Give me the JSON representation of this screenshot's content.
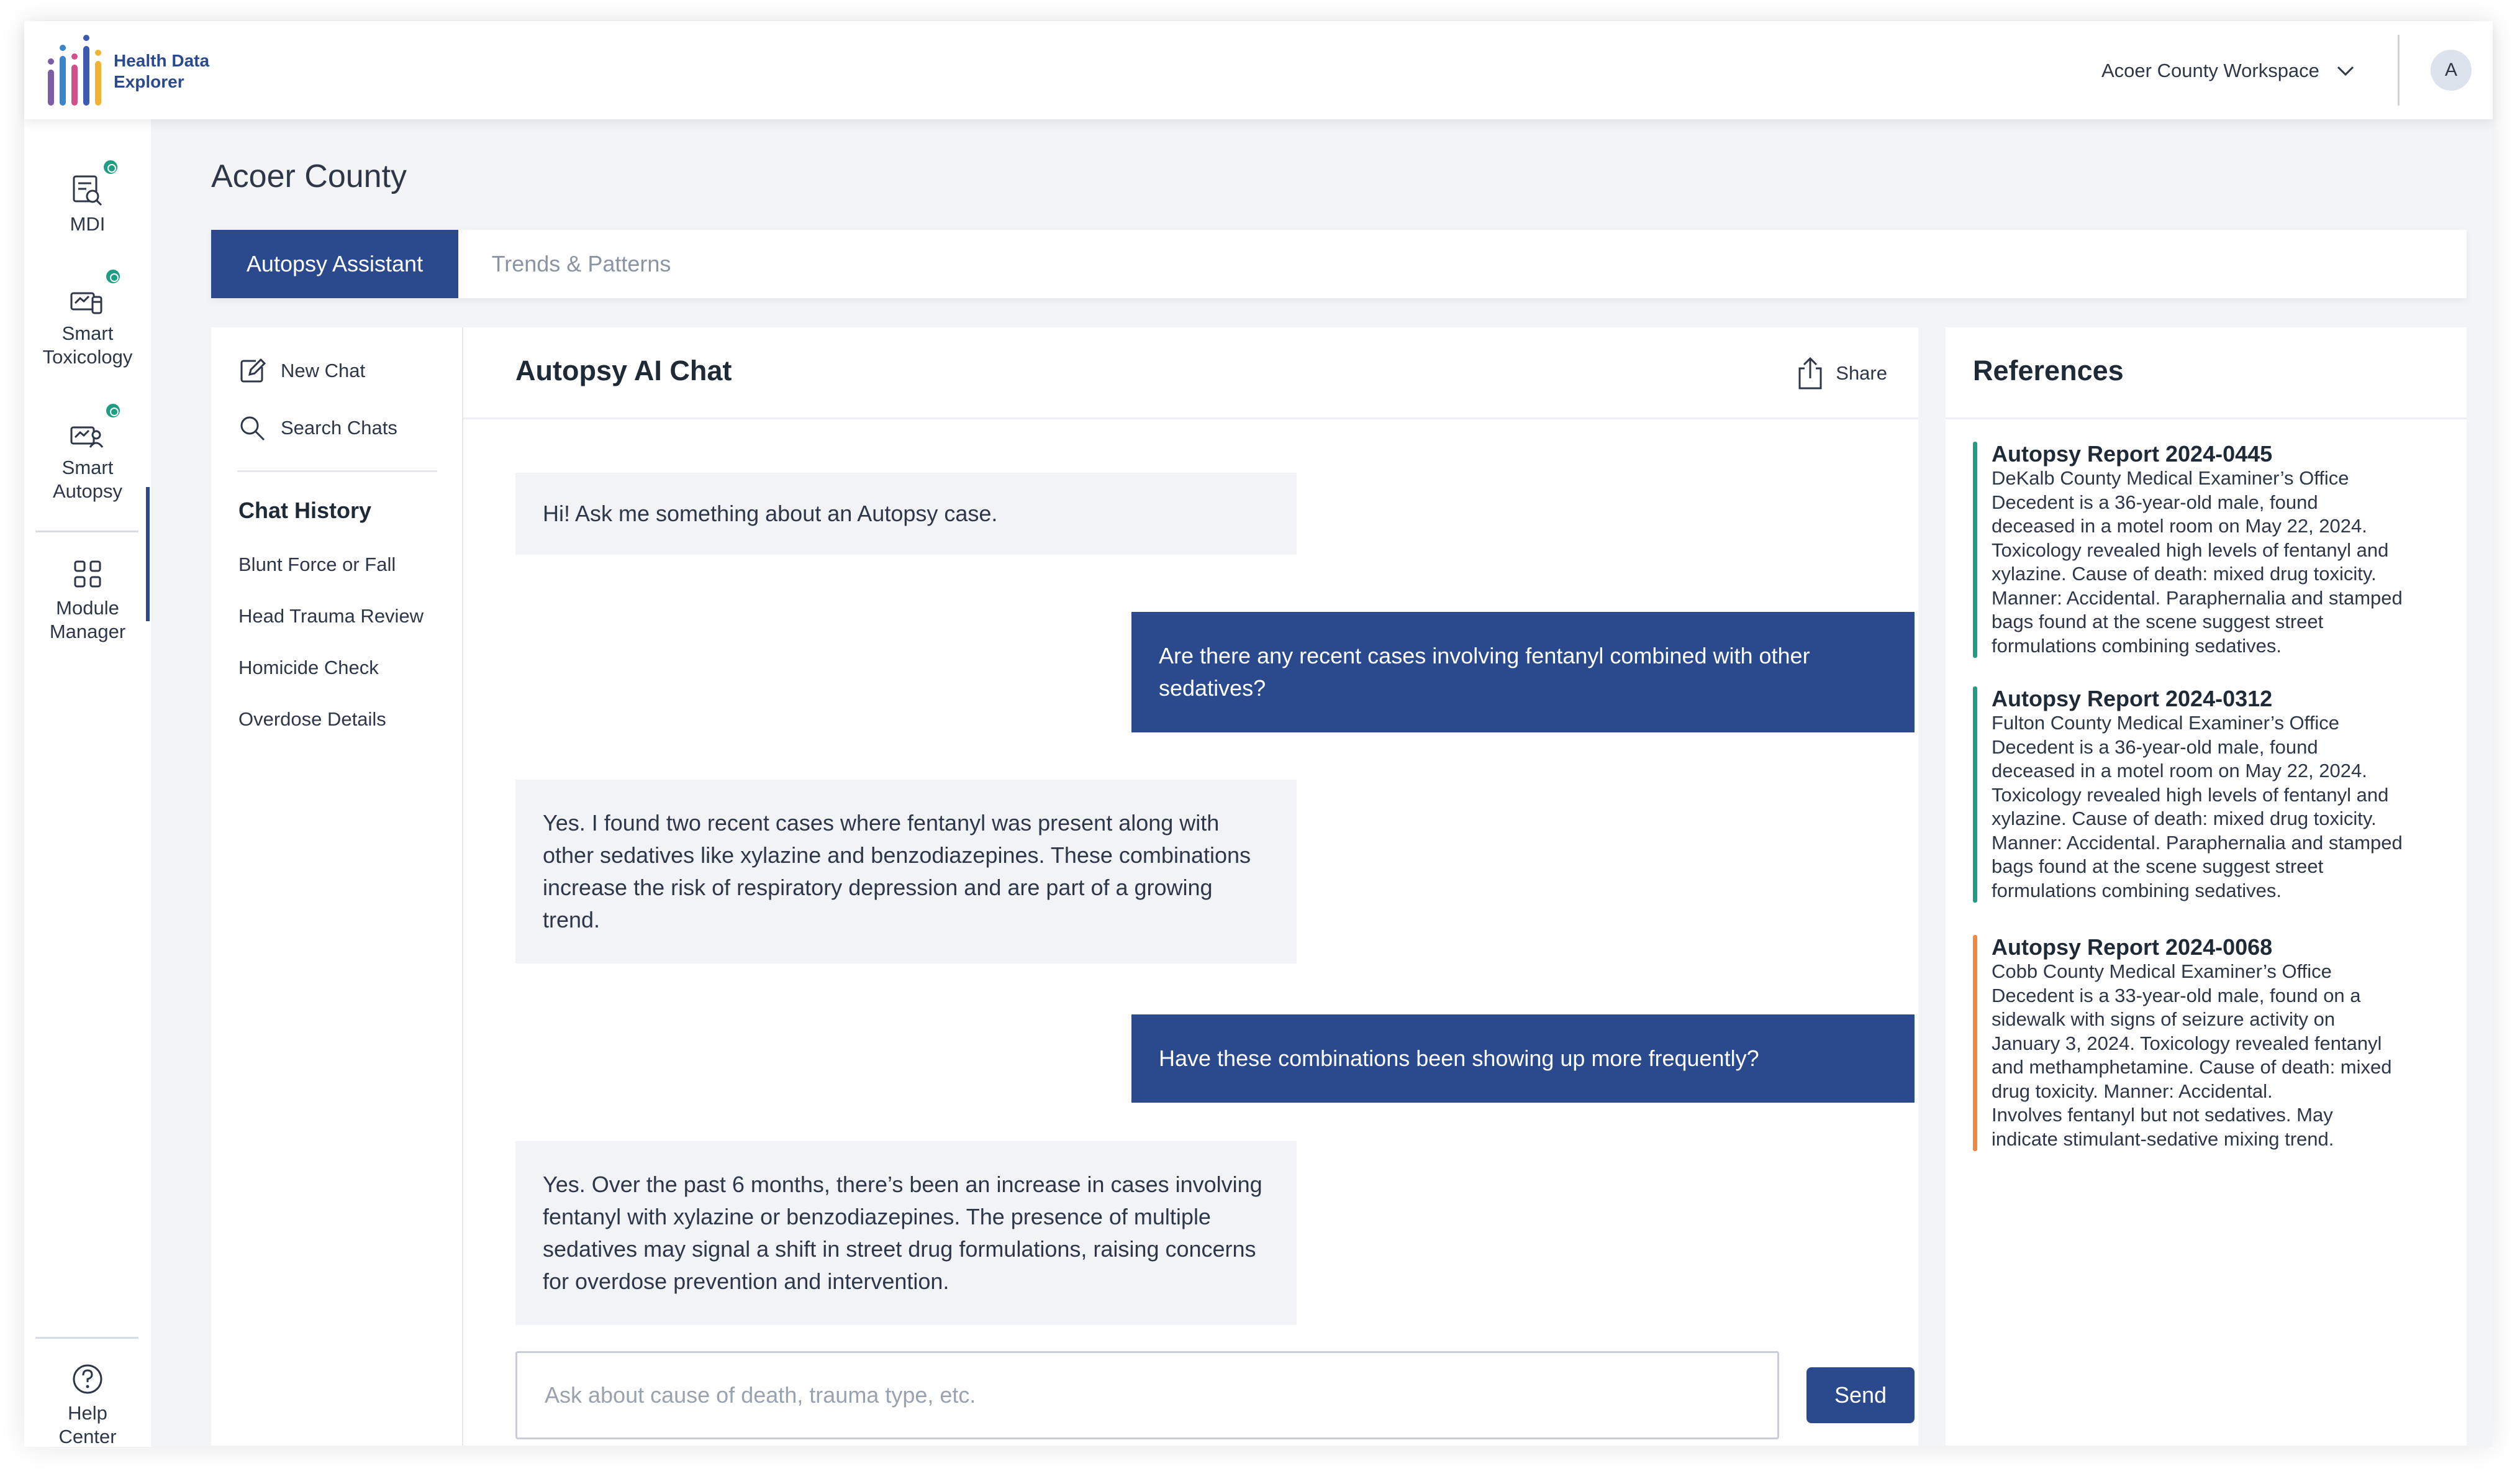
{
  "app": {
    "logo_line1": "Health Data",
    "logo_line2": "Explorer"
  },
  "header": {
    "workspace": "Acoer County Workspace",
    "avatar_initial": "A"
  },
  "sidebar": {
    "items": [
      {
        "label_line1": "MDI",
        "label_line2": "",
        "icon": "mdi-report-icon"
      },
      {
        "label_line1": "Smart",
        "label_line2": "Toxicology",
        "icon": "toxicology-icon"
      },
      {
        "label_line1": "Smart",
        "label_line2": "Autopsy",
        "icon": "autopsy-icon"
      },
      {
        "label_line1": "Module",
        "label_line2": "Manager",
        "icon": "module-grid-icon"
      }
    ],
    "help": {
      "label_line1": "Help",
      "label_line2": "Center",
      "icon": "help-circle-icon"
    }
  },
  "page": {
    "title": "Acoer County"
  },
  "tabs": [
    {
      "label": "Autopsy Assistant",
      "active": true
    },
    {
      "label": "Trends & Patterns",
      "active": false
    }
  ],
  "chat_list": {
    "new_chat": "New Chat",
    "search_chats": "Search Chats",
    "history_heading": "Chat History",
    "history": [
      "Blunt Force or Fall",
      "Head Trauma Review",
      "Homicide Check",
      "Overdose Details"
    ]
  },
  "chat": {
    "title": "Autopsy AI Chat",
    "share_label": "Share",
    "messages": [
      {
        "role": "bot",
        "text": "Hi! Ask me something about an Autopsy case."
      },
      {
        "role": "user",
        "text": "Are there any recent cases involving fentanyl combined with other sedatives?"
      },
      {
        "role": "bot",
        "text": "Yes. I found two recent cases where fentanyl was present along with other sedatives like xylazine and benzodiazepines. These combinations increase the risk of respiratory depression and are part of a growing trend."
      },
      {
        "role": "user",
        "text": "Have these combinations been showing up more frequently?"
      },
      {
        "role": "bot",
        "text": "Yes. Over the past 6 months, there’s been an increase in cases involving fentanyl with xylazine or benzodiazepines. The presence of multiple sedatives may signal a shift in street drug formulations, raising concerns for overdose prevention and intervention."
      }
    ],
    "input_placeholder": "Ask about cause of death, trauma type, etc.",
    "input_value": "",
    "send_label": "Send"
  },
  "references": {
    "title": "References",
    "items": [
      {
        "title": "Autopsy Report 2024-0445",
        "office": "DeKalb County Medical Examiner’s Office",
        "body": "Decedent is a 36-year-old male, found\ndeceased in a motel room on May 22, 2024.\n Toxicology revealed high levels of fentanyl and\nxylazine. Cause of death: mixed drug toxicity.\nManner: Accidental. Paraphernalia and stamped\nbags found at the scene suggest street\nformulations combining sedatives.",
        "color": "#1f9e83"
      },
      {
        "title": "Autopsy Report 2024-0312",
        "office": "Fulton County Medical Examiner’s Office",
        "body": "Decedent is a 36-year-old male, found\ndeceased in a motel room on May 22, 2024.\n Toxicology revealed high levels of fentanyl and\nxylazine. Cause of death: mixed drug toxicity.\nManner: Accidental. Paraphernalia and stamped\nbags found at the scene suggest street\nformulations combining sedatives.",
        "color": "#1f9e83"
      },
      {
        "title": "Autopsy Report 2024-0068",
        "office": "Cobb County Medical Examiner’s Office",
        "body": "Decedent is a 33-year-old male, found on a\nsidewalk with signs of seizure activity on\nJanuary 3, 2024. Toxicology revealed fentanyl\nand methamphetamine. Cause of death: mixed\ndrug toxicity. Manner: Accidental.\nInvolves fentanyl but not sedatives. May\nindicate stimulant-sedative mixing trend.",
        "color": "#f0883e"
      }
    ]
  },
  "colors": {
    "primary": "#2b4a8e",
    "badge_green": "#1f9e83",
    "ref_green": "#1f9e83",
    "ref_orange": "#f0883e"
  }
}
